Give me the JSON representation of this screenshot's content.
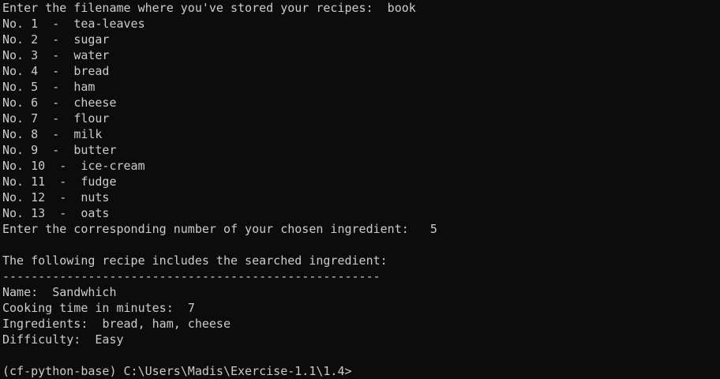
{
  "terminal": {
    "prompt_filename": {
      "text": "Enter the filename where you've stored your recipes:",
      "value": "book"
    },
    "ingredients": [
      {
        "label": "No. 1",
        "sep": "-",
        "name": "tea-leaves"
      },
      {
        "label": "No. 2",
        "sep": "-",
        "name": "sugar"
      },
      {
        "label": "No. 3",
        "sep": "-",
        "name": "water"
      },
      {
        "label": "No. 4",
        "sep": "-",
        "name": "bread"
      },
      {
        "label": "No. 5",
        "sep": "-",
        "name": "ham"
      },
      {
        "label": "No. 6",
        "sep": "-",
        "name": "cheese"
      },
      {
        "label": "No. 7",
        "sep": "-",
        "name": "flour"
      },
      {
        "label": "No. 8",
        "sep": "-",
        "name": "milk"
      },
      {
        "label": "No. 9",
        "sep": "-",
        "name": "butter"
      },
      {
        "label": "No. 10",
        "sep": "-",
        "name": "ice-cream"
      },
      {
        "label": "No. 11",
        "sep": "-",
        "name": "fudge"
      },
      {
        "label": "No. 12",
        "sep": "-",
        "name": "nuts"
      },
      {
        "label": "No. 13",
        "sep": "-",
        "name": "oats"
      }
    ],
    "prompt_number": {
      "text": "Enter the corresponding number of your chosen ingredient:",
      "value": "5"
    },
    "result_header": "The following recipe includes the searched ingredient:",
    "divider": "-----------------------------------------------------",
    "recipe": {
      "name_label": "Name:",
      "name_value": "Sandwhich",
      "time_label": "Cooking time in minutes:",
      "time_value": "7",
      "ingredients_label": "Ingredients:",
      "ingredients_value": "bread, ham, cheese",
      "difficulty_label": "Difficulty:",
      "difficulty_value": "Easy"
    },
    "shell_prompt": "(cf-python-base) C:\\Users\\Madis\\Exercise-1.1\\1.4>"
  },
  "colors": {
    "background": "#0c0c0c",
    "foreground": "#cccccc"
  }
}
